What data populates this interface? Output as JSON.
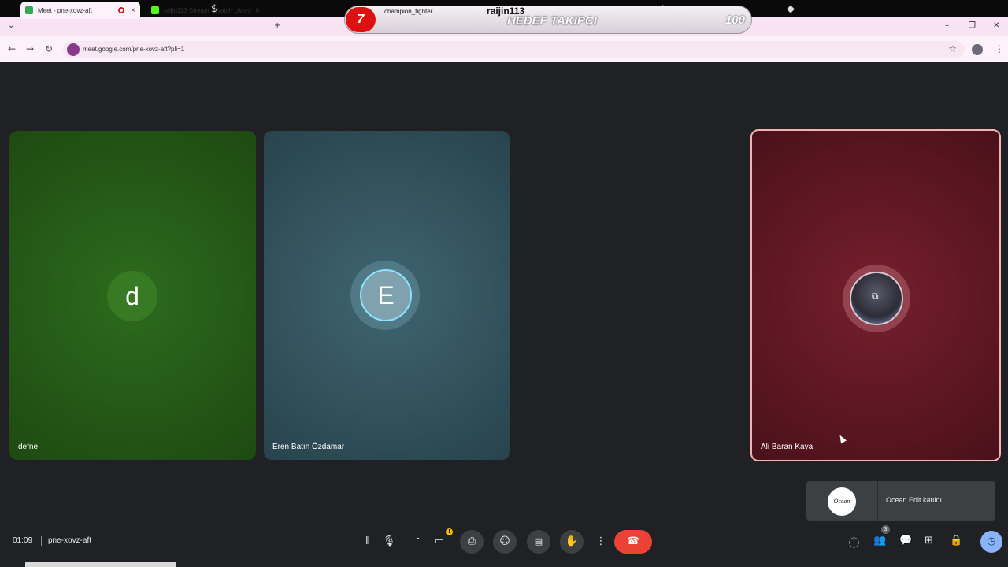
{
  "overlay": {
    "streamer": "champion_fighter",
    "brand": "raijin113",
    "goal_label": "HEDEF TAKIPCI",
    "badge_number": "7",
    "goal_count": "100",
    "icons": [
      "currency-icon",
      "star-icon",
      "diamond-icon"
    ]
  },
  "browser": {
    "tabs": [
      {
        "label": "Meet - pne-xovz-aft",
        "favicon": "meet-icon",
        "recording": true
      },
      {
        "label": "raijin113 Stream - Watch Live o",
        "favicon": "kick-icon"
      }
    ],
    "new_tab": "+",
    "url": "meet.google.com/pne-xovz-aft?pli=1"
  },
  "participants": [
    {
      "name": "defne",
      "initial": "d",
      "color": "#387a24"
    },
    {
      "name": "Eren Batın Özdamar",
      "initial": "E",
      "color": "#7fa2ae"
    },
    {
      "name": "Ali Baran Kaya",
      "initial": "",
      "color": "#761f2c",
      "speaking": true
    }
  ],
  "toast": {
    "logo_text": "Ocean",
    "message": "Ocean Edit katıldı"
  },
  "meeting": {
    "time": "01:09",
    "code": "pne-xovz-aft",
    "participant_count": "3"
  },
  "controls": {
    "center": [
      "audio-settings-icon",
      "microphone-icon",
      "chevron-up-icon",
      "camera-icon",
      "present-icon",
      "emoji-icon",
      "captions-icon",
      "raise-hand-icon",
      "more-options-icon",
      "end-call-icon"
    ],
    "right": [
      "info-icon",
      "people-icon",
      "chat-icon",
      "activities-icon",
      "host-controls-icon",
      "timer-icon"
    ]
  }
}
